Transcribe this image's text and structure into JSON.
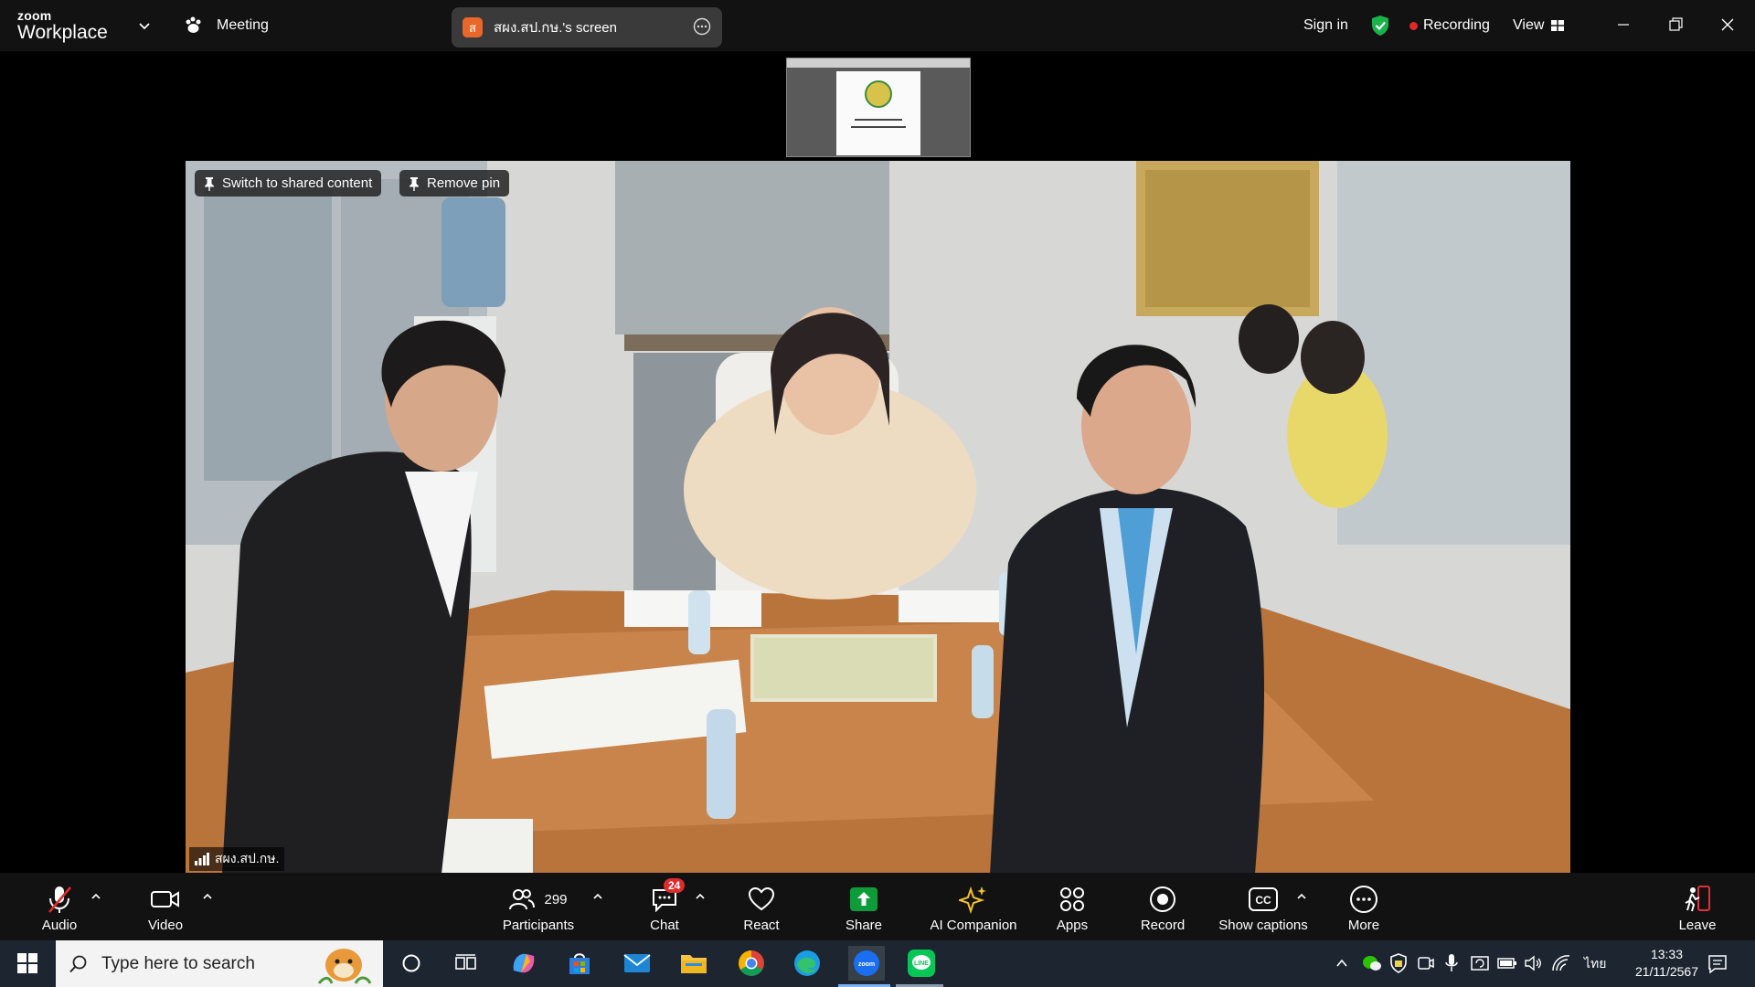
{
  "titlebar": {
    "brand_small": "zoom",
    "brand_big": "Workplace",
    "meeting_label": "Meeting",
    "share_badge": "ส",
    "share_title": "สผง.สป.กษ.'s screen",
    "sign_in": "Sign in",
    "recording": "Recording",
    "view": "View"
  },
  "video": {
    "switch_label": "Switch to shared content",
    "remove_pin_label": "Remove pin",
    "participant_name": "สผง.สป.กษ."
  },
  "toolbar": {
    "audio": "Audio",
    "video": "Video",
    "participants": "Participants",
    "participants_count": "299",
    "chat": "Chat",
    "chat_badge": "24",
    "react": "React",
    "share": "Share",
    "ai_companion": "AI Companion",
    "apps": "Apps",
    "record": "Record",
    "captions": "Show captions",
    "more": "More",
    "leave": "Leave"
  },
  "taskbar": {
    "search_placeholder": "Type here to search",
    "language": "ไทย",
    "time": "13:33",
    "date": "21/11/2567"
  },
  "colors": {
    "share_green": "#0e9c3a",
    "recording_red": "#e02828",
    "shield_green": "#19b34a",
    "ai_gold": "#f2c12e",
    "leave_red": "#e0303a"
  }
}
